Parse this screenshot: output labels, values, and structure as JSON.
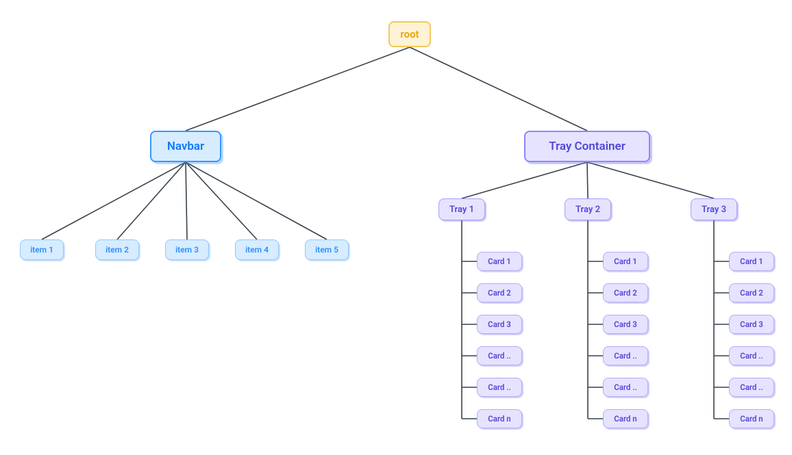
{
  "root": {
    "label": "root"
  },
  "navbar": {
    "label": "Navbar",
    "items": [
      {
        "label": "item 1"
      },
      {
        "label": "item 2"
      },
      {
        "label": "item 3"
      },
      {
        "label": "item 4"
      },
      {
        "label": "item 5"
      }
    ]
  },
  "tray_container": {
    "label": "Tray Container",
    "trays": [
      {
        "label": "Tray 1",
        "cards": [
          {
            "label": "Card 1"
          },
          {
            "label": "Card 2"
          },
          {
            "label": "Card 3"
          },
          {
            "label": "Card .."
          },
          {
            "label": "Card .."
          },
          {
            "label": "Card n"
          }
        ]
      },
      {
        "label": "Tray 2",
        "cards": [
          {
            "label": "Card 1"
          },
          {
            "label": "Card 2"
          },
          {
            "label": "Card 3"
          },
          {
            "label": "Card .."
          },
          {
            "label": "Card .."
          },
          {
            "label": "Card n"
          }
        ]
      },
      {
        "label": "Tray 3",
        "cards": [
          {
            "label": "Card 1"
          },
          {
            "label": "Card 2"
          },
          {
            "label": "Card 3"
          },
          {
            "label": "Card .."
          },
          {
            "label": "Card .."
          },
          {
            "label": "Card n"
          }
        ]
      }
    ]
  },
  "colors": {
    "edge": "#37424d",
    "root_bg": "#fff3d6",
    "root_border": "#f5c955",
    "root_text": "#e6a400",
    "blue_bg": "#d7ecff",
    "blue_border": "#3a97ff",
    "blue_text": "#0b78ff",
    "purple_bg": "#e5e3ff",
    "purple_border": "#8f86f7",
    "purple_text": "#5247d6"
  }
}
